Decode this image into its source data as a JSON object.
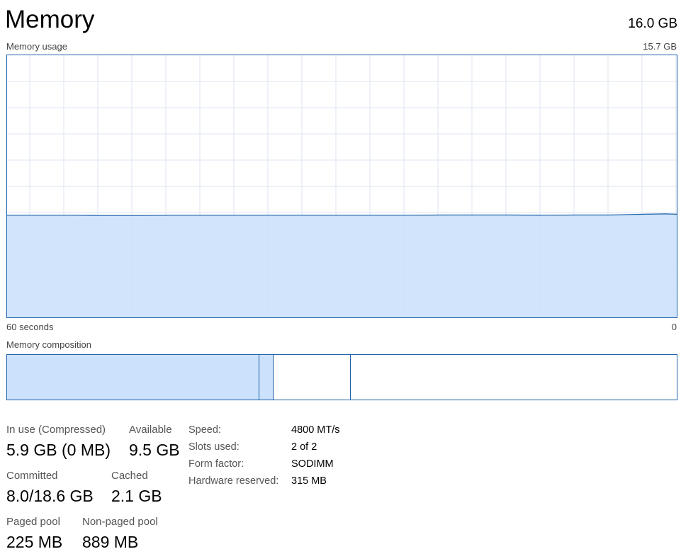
{
  "header": {
    "title": "Memory",
    "total": "16.0 GB"
  },
  "usage_graph": {
    "label": "Memory usage",
    "max": "15.7 GB",
    "time_left": "60 seconds",
    "time_right": "0",
    "fill_color": "#cce1fb",
    "line_color": "#1a5fa8",
    "grid_color": "#dce6f0"
  },
  "chart_data": {
    "type": "area",
    "x": [
      60,
      57,
      54,
      51,
      48,
      45,
      42,
      39,
      36,
      33,
      30,
      27,
      24,
      21,
      18,
      15,
      12,
      9,
      6,
      3,
      1,
      0
    ],
    "values": [
      6.12,
      6.12,
      6.12,
      6.1,
      6.1,
      6.12,
      6.12,
      6.12,
      6.12,
      6.12,
      6.12,
      6.12,
      6.12,
      6.13,
      6.13,
      6.13,
      6.12,
      6.13,
      6.13,
      6.18,
      6.2,
      6.18
    ],
    "ylim": [
      0,
      15.7
    ],
    "xlim": [
      60,
      0
    ]
  },
  "composition": {
    "label": "Memory composition",
    "in_use_fraction": 0.377,
    "modified_fraction": 0.021,
    "standby_fraction": 0.115,
    "free_fraction": 0.487
  },
  "stats": {
    "in_use": {
      "label": "In use (Compressed)",
      "value": "5.9 GB (0 MB)"
    },
    "available": {
      "label": "Available",
      "value": "9.5 GB"
    },
    "committed": {
      "label": "Committed",
      "value": "8.0/18.6 GB"
    },
    "cached": {
      "label": "Cached",
      "value": "2.1 GB"
    },
    "paged_pool": {
      "label": "Paged pool",
      "value": "225 MB"
    },
    "nonpaged_pool": {
      "label": "Non-paged pool",
      "value": "889 MB"
    }
  },
  "specs": {
    "speed": {
      "label": "Speed:",
      "value": "4800 MT/s"
    },
    "slots": {
      "label": "Slots used:",
      "value": "2 of 2"
    },
    "form_factor": {
      "label": "Form factor:",
      "value": "SODIMM"
    },
    "hw_reserved": {
      "label": "Hardware reserved:",
      "value": "315 MB"
    }
  }
}
